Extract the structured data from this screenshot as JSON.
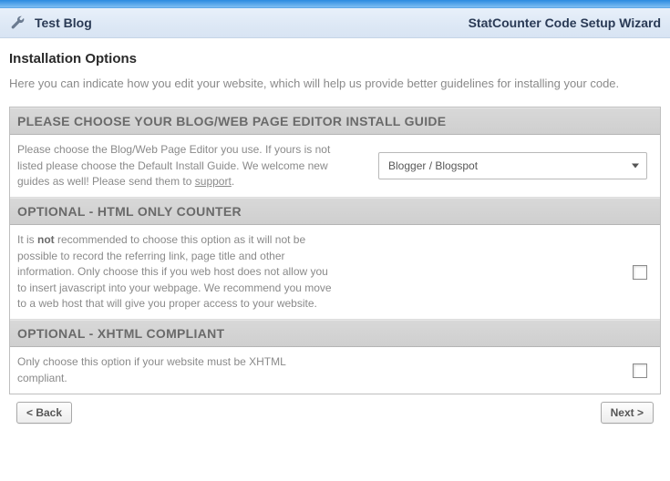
{
  "topbar": {},
  "header": {
    "title": "Test Blog",
    "wizard_title": "StatCounter Code Setup Wizard"
  },
  "page": {
    "heading": "Installation Options",
    "intro": "Here you can indicate how you edit your website, which will help us provide better guidelines for installing your code."
  },
  "boxes": [
    {
      "header": "PLEASE CHOOSE YOUR BLOG/WEB PAGE EDITOR INSTALL GUIDE",
      "text_pre": "Please choose the Blog/Web Page Editor you use. If yours is not listed please choose the Default Install Guide. We welcome new guides as well! Please send them to ",
      "link_text": "support",
      "text_post": ".",
      "control": {
        "type": "select",
        "value": "Blogger / Blogspot"
      }
    },
    {
      "header": "OPTIONAL - HTML ONLY COUNTER",
      "text_pre": "It is ",
      "strong": "not",
      "text_post": " recommended to choose this option as it will not be possible to record the referring link, page title and other information. Only choose this if you web host does not allow you to insert javascript into your webpage. We recommend you move to a web host that will give you proper access to your website.",
      "control": {
        "type": "checkbox",
        "checked": false
      }
    },
    {
      "header": "OPTIONAL - XHTML COMPLIANT",
      "text_pre": "Only choose this option if your website must be XHTML compliant.",
      "control": {
        "type": "checkbox",
        "checked": false
      }
    }
  ],
  "buttons": {
    "back": "< Back",
    "next": "Next >"
  }
}
